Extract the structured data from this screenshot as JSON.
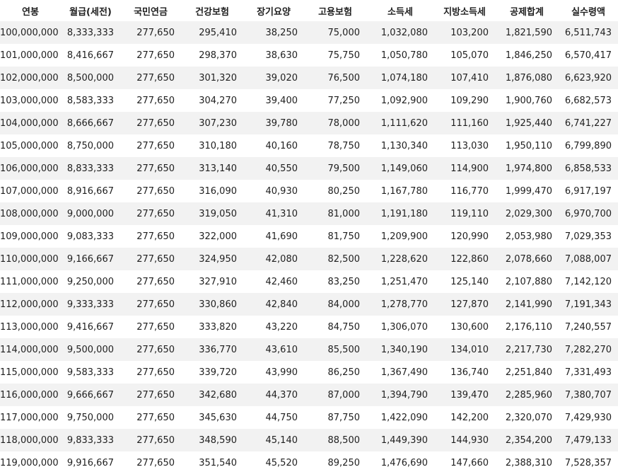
{
  "table": {
    "headers": [
      "연봉",
      "월급(세전)",
      "국민연금",
      "건강보험",
      "장기요양",
      "고용보험",
      "소득세",
      "지방소득세",
      "공제합계",
      "실수령액"
    ],
    "rows": [
      [
        "100,000,000",
        "8,333,333",
        "277,650",
        "295,410",
        "38,250",
        "75,000",
        "1,032,080",
        "103,200",
        "1,821,590",
        "6,511,743"
      ],
      [
        "101,000,000",
        "8,416,667",
        "277,650",
        "298,370",
        "38,630",
        "75,750",
        "1,050,780",
        "105,070",
        "1,846,250",
        "6,570,417"
      ],
      [
        "102,000,000",
        "8,500,000",
        "277,650",
        "301,320",
        "39,020",
        "76,500",
        "1,074,180",
        "107,410",
        "1,876,080",
        "6,623,920"
      ],
      [
        "103,000,000",
        "8,583,333",
        "277,650",
        "304,270",
        "39,400",
        "77,250",
        "1,092,900",
        "109,290",
        "1,900,760",
        "6,682,573"
      ],
      [
        "104,000,000",
        "8,666,667",
        "277,650",
        "307,230",
        "39,780",
        "78,000",
        "1,111,620",
        "111,160",
        "1,925,440",
        "6,741,227"
      ],
      [
        "105,000,000",
        "8,750,000",
        "277,650",
        "310,180",
        "40,160",
        "78,750",
        "1,130,340",
        "113,030",
        "1,950,110",
        "6,799,890"
      ],
      [
        "106,000,000",
        "8,833,333",
        "277,650",
        "313,140",
        "40,550",
        "79,500",
        "1,149,060",
        "114,900",
        "1,974,800",
        "6,858,533"
      ],
      [
        "107,000,000",
        "8,916,667",
        "277,650",
        "316,090",
        "40,930",
        "80,250",
        "1,167,780",
        "116,770",
        "1,999,470",
        "6,917,197"
      ],
      [
        "108,000,000",
        "9,000,000",
        "277,650",
        "319,050",
        "41,310",
        "81,000",
        "1,191,180",
        "119,110",
        "2,029,300",
        "6,970,700"
      ],
      [
        "109,000,000",
        "9,083,333",
        "277,650",
        "322,000",
        "41,690",
        "81,750",
        "1,209,900",
        "120,990",
        "2,053,980",
        "7,029,353"
      ],
      [
        "110,000,000",
        "9,166,667",
        "277,650",
        "324,950",
        "42,080",
        "82,500",
        "1,228,620",
        "122,860",
        "2,078,660",
        "7,088,007"
      ],
      [
        "111,000,000",
        "9,250,000",
        "277,650",
        "327,910",
        "42,460",
        "83,250",
        "1,251,470",
        "125,140",
        "2,107,880",
        "7,142,120"
      ],
      [
        "112,000,000",
        "9,333,333",
        "277,650",
        "330,860",
        "42,840",
        "84,000",
        "1,278,770",
        "127,870",
        "2,141,990",
        "7,191,343"
      ],
      [
        "113,000,000",
        "9,416,667",
        "277,650",
        "333,820",
        "43,220",
        "84,750",
        "1,306,070",
        "130,600",
        "2,176,110",
        "7,240,557"
      ],
      [
        "114,000,000",
        "9,500,000",
        "277,650",
        "336,770",
        "43,610",
        "85,500",
        "1,340,190",
        "134,010",
        "2,217,730",
        "7,282,270"
      ],
      [
        "115,000,000",
        "9,583,333",
        "277,650",
        "339,720",
        "43,990",
        "86,250",
        "1,367,490",
        "136,740",
        "2,251,840",
        "7,331,493"
      ],
      [
        "116,000,000",
        "9,666,667",
        "277,650",
        "342,680",
        "44,370",
        "87,000",
        "1,394,790",
        "139,470",
        "2,285,960",
        "7,380,707"
      ],
      [
        "117,000,000",
        "9,750,000",
        "277,650",
        "345,630",
        "44,750",
        "87,750",
        "1,422,090",
        "142,200",
        "2,320,070",
        "7,429,930"
      ],
      [
        "118,000,000",
        "9,833,333",
        "277,650",
        "348,590",
        "45,140",
        "88,500",
        "1,449,390",
        "144,930",
        "2,354,200",
        "7,479,133"
      ],
      [
        "119,000,000",
        "9,916,667",
        "277,650",
        "351,540",
        "45,520",
        "89,250",
        "1,476,690",
        "147,660",
        "2,388,310",
        "7,528,357"
      ]
    ]
  }
}
